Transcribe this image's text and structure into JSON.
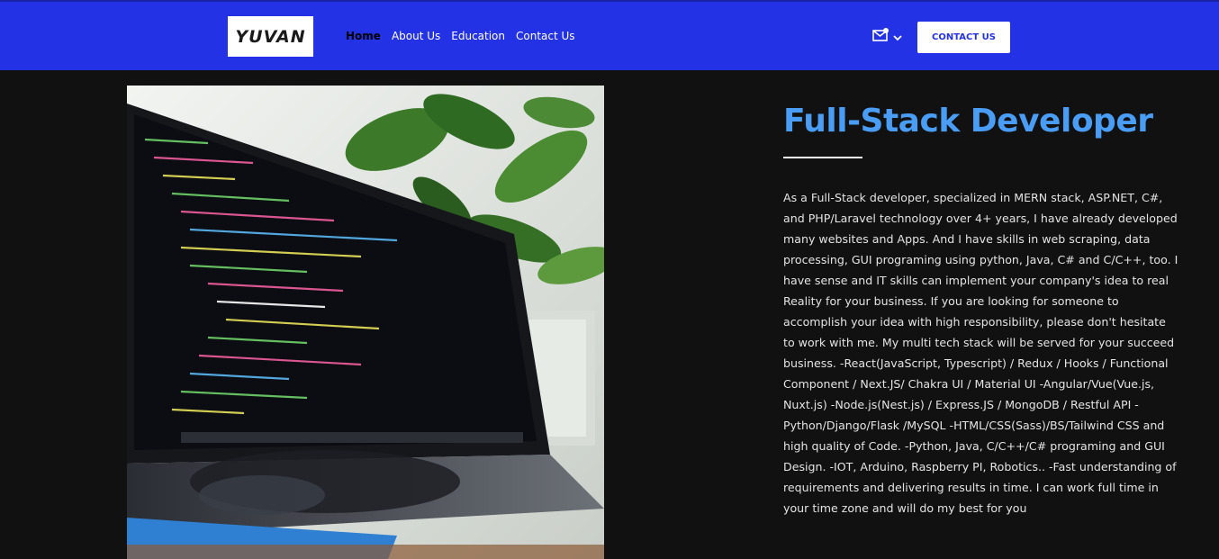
{
  "header": {
    "logo_text": "YUVAN",
    "nav": [
      {
        "label": "Home",
        "active": true
      },
      {
        "label": "About Us",
        "active": false
      },
      {
        "label": "Education",
        "active": false
      },
      {
        "label": "Contact Us",
        "active": false
      }
    ],
    "mail_icon": "mail-icon",
    "cta_label": "CONTACT US"
  },
  "hero": {
    "image": "laptop-code-photo",
    "title": "Full-Stack Developer",
    "description": "As a Full-Stack developer, specialized in MERN stack, ASP.NET, C#, and PHP/Laravel technology over 4+ years, I have already developed many websites and Apps. And I have skills in web scraping, data processing, GUI programing using python, Java, C# and C/C++, too. I have sense and IT skills can implement your company's idea to real Reality for your business. If you are looking for someone to accomplish your idea with high responsibility, please don't hesitate to work with me. My multi tech stack will be served for your succeed business. -React(JavaScript, Typescript) / Redux / Hooks / Functional Component / Next.JS/ Chakra UI / Material UI -Angular/Vue(Vue.js, Nuxt.js) -Node.js(Nest.js) / Express.JS / MongoDB / Restful API -Python/Django/Flask /MySQL -HTML/CSS(Sass)/BS/Tailwind CSS and high quality of Code. -Python, Java, C/C++/C# programing and GUI Design. -IOT, Arduino, Raspberry PI, Robotics.. -Fast understanding of requirements and delivering results in time. I can work full time in your time zone and will do my best for you"
  },
  "colors": {
    "navbar": "#2432e6",
    "accent_title": "#4a9df5",
    "background": "#111111"
  }
}
